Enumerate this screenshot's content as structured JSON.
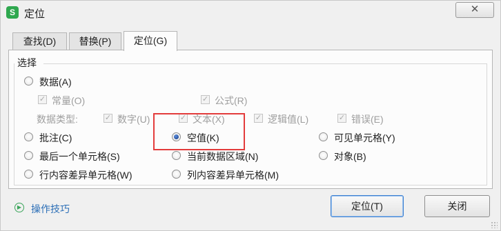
{
  "window": {
    "app_icon_label": "S",
    "title": "定位",
    "close_symbol": "✕"
  },
  "tabs": [
    {
      "label": "查找(D)",
      "active": false
    },
    {
      "label": "替换(P)",
      "active": false
    },
    {
      "label": "定位(G)",
      "active": true
    }
  ],
  "group": {
    "legend": "选择"
  },
  "options": {
    "data": {
      "label": "数据(A)",
      "checked": false
    },
    "constants": {
      "label": "常量(O)",
      "checked": true,
      "disabled": true
    },
    "formulas": {
      "label": "公式(R)",
      "checked": true,
      "disabled": true
    },
    "data_types_label": "数据类型:",
    "data_types": [
      {
        "label": "数字(U)",
        "checked": true,
        "disabled": true
      },
      {
        "label": "文本(X)",
        "checked": true,
        "disabled": true
      },
      {
        "label": "逻辑值(L)",
        "checked": true,
        "disabled": true
      },
      {
        "label": "错误(E)",
        "checked": true,
        "disabled": true
      }
    ],
    "comments": {
      "label": "批注(C)",
      "checked": false
    },
    "blanks": {
      "label": "空值(K)",
      "checked": true
    },
    "visible_cells": {
      "label": "可见单元格(Y)",
      "checked": false
    },
    "last_cell": {
      "label": "最后一个单元格(S)",
      "checked": false
    },
    "current_region": {
      "label": "当前数据区域(N)",
      "checked": false
    },
    "objects": {
      "label": "对象(B)",
      "checked": false
    },
    "row_differences": {
      "label": "行内容差异单元格(W)",
      "checked": false
    },
    "column_differences": {
      "label": "列内容差异单元格(M)",
      "checked": false
    }
  },
  "footer": {
    "tips_label": "操作技巧",
    "ok_label": "定位(T)",
    "cancel_label": "关闭"
  },
  "colors": {
    "highlight": "#e33b3b",
    "link": "#2c6fb7",
    "brand": "#2fa84f"
  }
}
